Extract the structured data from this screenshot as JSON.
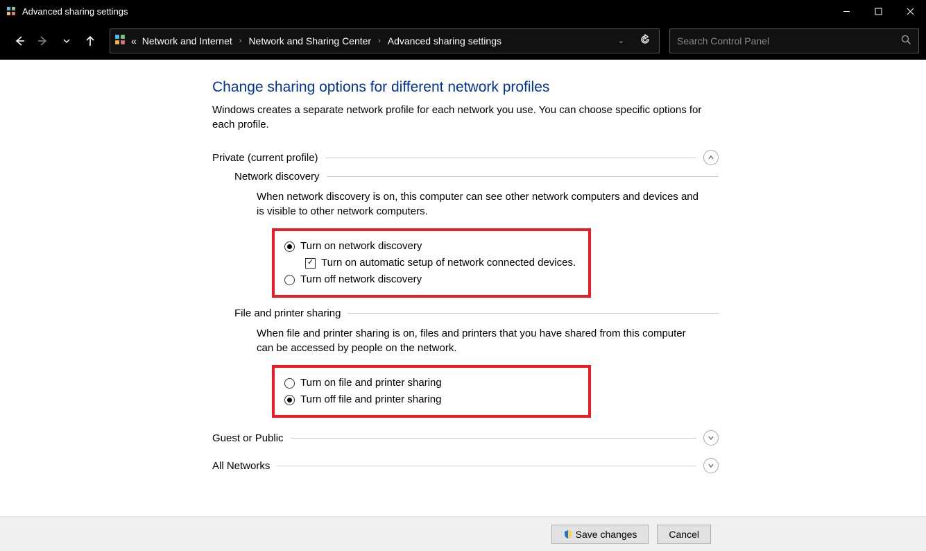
{
  "titlebar": {
    "title": "Advanced sharing settings"
  },
  "breadcrumb": {
    "prefix": "«",
    "items": [
      "Network and Internet",
      "Network and Sharing Center",
      "Advanced sharing settings"
    ]
  },
  "search": {
    "placeholder": "Search Control Panel"
  },
  "page": {
    "title": "Change sharing options for different network profiles",
    "description": "Windows creates a separate network profile for each network you use. You can choose specific options for each profile."
  },
  "sections": {
    "private": {
      "label": "Private (current profile)",
      "network_discovery": {
        "title": "Network discovery",
        "description": "When network discovery is on, this computer can see other network computers and devices and is visible to other network computers.",
        "option_on": "Turn on network discovery",
        "option_auto": "Turn on automatic setup of network connected devices.",
        "option_off": "Turn off network discovery"
      },
      "file_printer": {
        "title": "File and printer sharing",
        "description": "When file and printer sharing is on, files and printers that you have shared from this computer can be accessed by people on the network.",
        "option_on": "Turn on file and printer sharing",
        "option_off": "Turn off file and printer sharing"
      }
    },
    "guest": {
      "label": "Guest or Public"
    },
    "all": {
      "label": "All Networks"
    }
  },
  "footer": {
    "save": "Save changes",
    "cancel": "Cancel"
  }
}
